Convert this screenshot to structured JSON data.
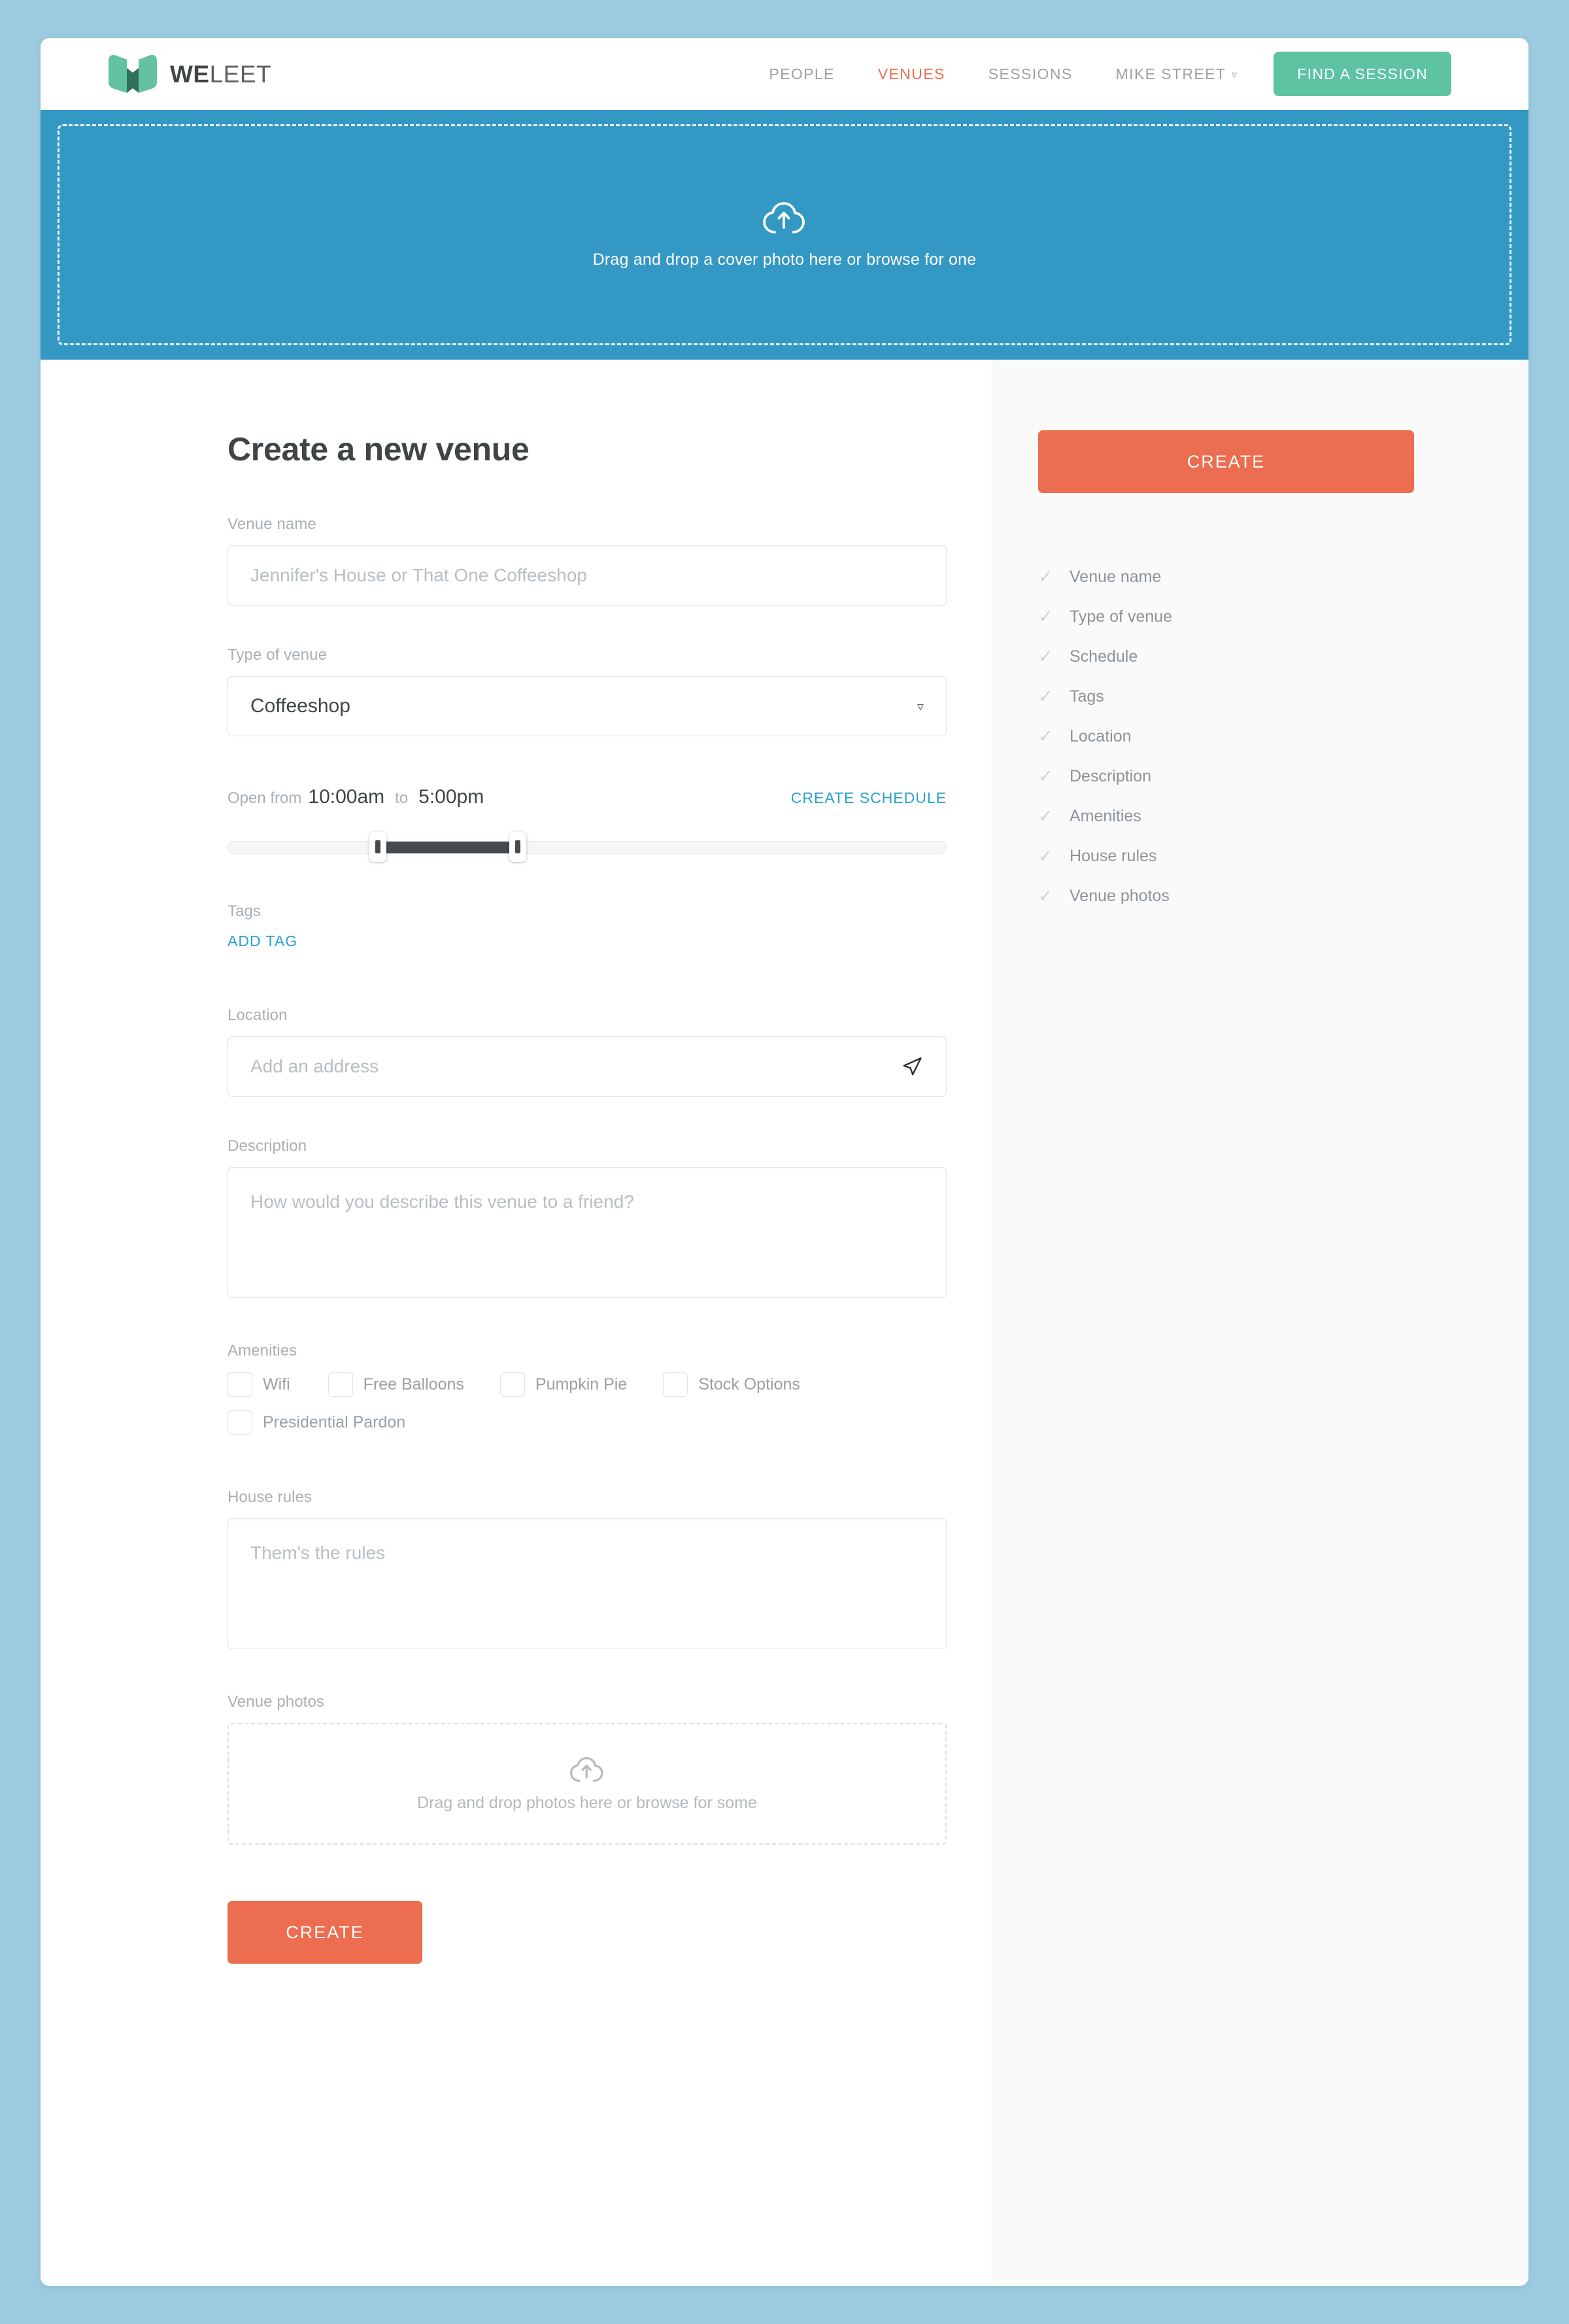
{
  "header": {
    "logo": {
      "we": "WE",
      "leet": "LEET",
      "icon": "weleet-logo-mark"
    },
    "nav": [
      {
        "label": "PEOPLE",
        "active": false
      },
      {
        "label": "VENUES",
        "active": true
      },
      {
        "label": "SESSIONS",
        "active": false
      }
    ],
    "user": {
      "name": "MIKE STREET",
      "caret": "▿"
    },
    "find_session_label": "FIND A SESSION"
  },
  "cover": {
    "icon": "cloud-upload-icon",
    "text": "Drag and drop a cover photo here or browse for one"
  },
  "main": {
    "title": "Create a new venue",
    "venue_name": {
      "label": "Venue name",
      "placeholder": "Jennifer's House or That One Coffeeshop",
      "value": ""
    },
    "type_of_venue": {
      "label": "Type of venue",
      "value": "Coffeeshop",
      "caret": "▿"
    },
    "schedule": {
      "prefix": "Open from",
      "start_time": "10:00am",
      "connector": "to",
      "end_time": "5:00pm",
      "link_label": "CREATE SCHEDULE"
    },
    "tags": {
      "label": "Tags",
      "add_label": "ADD TAG"
    },
    "location": {
      "label": "Location",
      "placeholder": "Add an address",
      "value": "",
      "icon": "send-location-icon"
    },
    "description": {
      "label": "Description",
      "placeholder": "How would you describe this venue to a friend?",
      "value": ""
    },
    "amenities": {
      "label": "Amenities",
      "row1": [
        "Wifi",
        "Free Balloons",
        "Pumpkin Pie",
        "Stock Options"
      ],
      "row2": [
        "Presidential Pardon"
      ]
    },
    "house_rules": {
      "label": "House rules",
      "placeholder": "Them's the rules",
      "value": ""
    },
    "venue_photos": {
      "label": "Venue photos",
      "icon": "cloud-upload-icon",
      "text": "Drag and drop photos here or browse for some"
    },
    "create_label": "CREATE"
  },
  "sidebar": {
    "create_label": "CREATE",
    "checklist": [
      {
        "label": "Venue name",
        "mark": "✓"
      },
      {
        "label": "Type of venue",
        "mark": "✓"
      },
      {
        "label": "Schedule",
        "mark": "✓"
      },
      {
        "label": "Tags",
        "mark": "✓"
      },
      {
        "label": "Location",
        "mark": "✓"
      },
      {
        "label": "Description",
        "mark": "✓"
      },
      {
        "label": "Amenities",
        "mark": "✓"
      },
      {
        "label": "House rules",
        "mark": "✓"
      },
      {
        "label": "Venue photos",
        "mark": "✓"
      }
    ]
  },
  "colors": {
    "page_background": "#9ccbe0",
    "cover_blue": "#3498c4",
    "accent_orange": "#ec6d4f",
    "accent_green": "#5dc3a2",
    "link_blue": "#27a0d4",
    "logo_light_green": "#63c2a0",
    "logo_dark_green": "#2f7158"
  }
}
